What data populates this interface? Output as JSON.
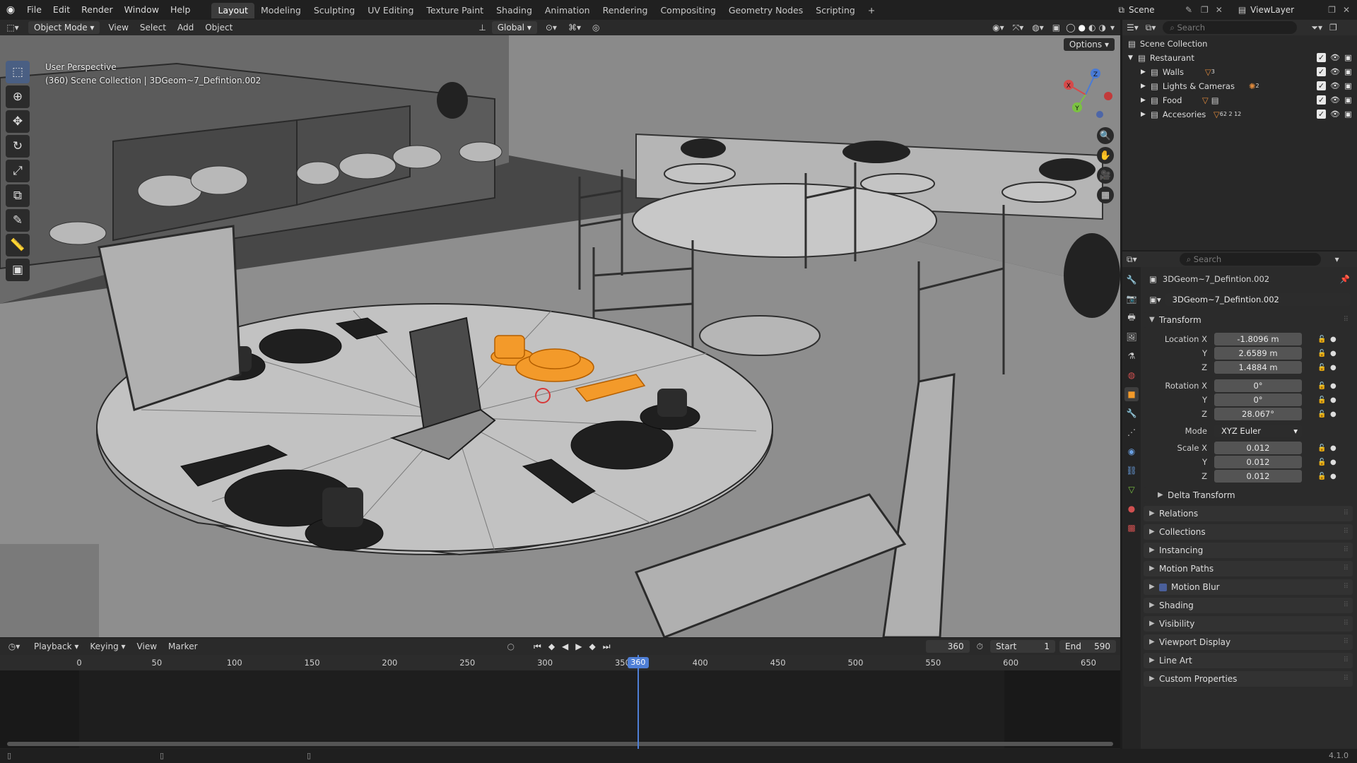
{
  "topbar": {
    "menus": [
      "File",
      "Edit",
      "Render",
      "Window",
      "Help"
    ],
    "workspaces": [
      "Layout",
      "Modeling",
      "Sculpting",
      "UV Editing",
      "Texture Paint",
      "Shading",
      "Animation",
      "Rendering",
      "Compositing",
      "Geometry Nodes",
      "Scripting"
    ],
    "active_workspace": "Layout",
    "add_tab": "+",
    "scene": "Scene",
    "view_layer": "ViewLayer"
  },
  "viewport_header": {
    "mode": "Object Mode",
    "menus": [
      "View",
      "Select",
      "Add",
      "Object"
    ],
    "transform_orientation": "Global"
  },
  "viewport": {
    "view_name": "User Perspective",
    "object_info": "(360) Scene Collection | 3DGeom~7_Defintion.002",
    "options_label": "Options",
    "gizmo_axes": {
      "x": "X",
      "y": "Y",
      "z": "Z"
    },
    "selection_color": "#f39a2a",
    "tools": [
      "select-box",
      "cursor",
      "move",
      "rotate",
      "scale",
      "transform",
      "annotate",
      "measure",
      "add-cube"
    ]
  },
  "outliner": {
    "search_placeholder": "Search",
    "root": "Scene Collection",
    "collection": "Restaurant",
    "children": [
      {
        "name": "Walls",
        "badge": "3"
      },
      {
        "name": "Lights & Cameras",
        "badge": "2"
      },
      {
        "name": "Food",
        "badge": ""
      },
      {
        "name": "Accesories",
        "badge": "62 2 12"
      }
    ]
  },
  "properties": {
    "search_placeholder": "Search",
    "object_name": "3DGeom~7_Defintion.002",
    "datablock_name": "3DGeom~7_Defintion.002",
    "transform_header": "Transform",
    "location": {
      "label": "Location X",
      "x": "-1.8096 m",
      "y": "2.6589 m",
      "z": "1.4884 m"
    },
    "rotation": {
      "label": "Rotation X",
      "x": "0°",
      "y": "0°",
      "z": "28.067°"
    },
    "mode": {
      "label": "Mode",
      "value": "XYZ Euler"
    },
    "scale": {
      "label": "Scale X",
      "x": "0.012",
      "y": "0.012",
      "z": "0.012"
    },
    "axis_y": "Y",
    "axis_z": "Z",
    "delta_transform": "Delta Transform",
    "panels": [
      "Relations",
      "Collections",
      "Instancing",
      "Motion Paths",
      "Motion Blur",
      "Shading",
      "Visibility",
      "Viewport Display",
      "Line Art",
      "Custom Properties"
    ]
  },
  "timeline": {
    "menus": [
      "Playback",
      "Keying",
      "View",
      "Marker"
    ],
    "current_frame": "360",
    "start_label": "Start",
    "start": "1",
    "end_label": "End",
    "end": "590",
    "ruler_ticks": [
      "0",
      "50",
      "100",
      "150",
      "200",
      "250",
      "300",
      "350",
      "400",
      "450",
      "500",
      "550",
      "600",
      "650"
    ],
    "playhead_label": "360"
  },
  "statusbar": {
    "version": "4.1.0"
  }
}
